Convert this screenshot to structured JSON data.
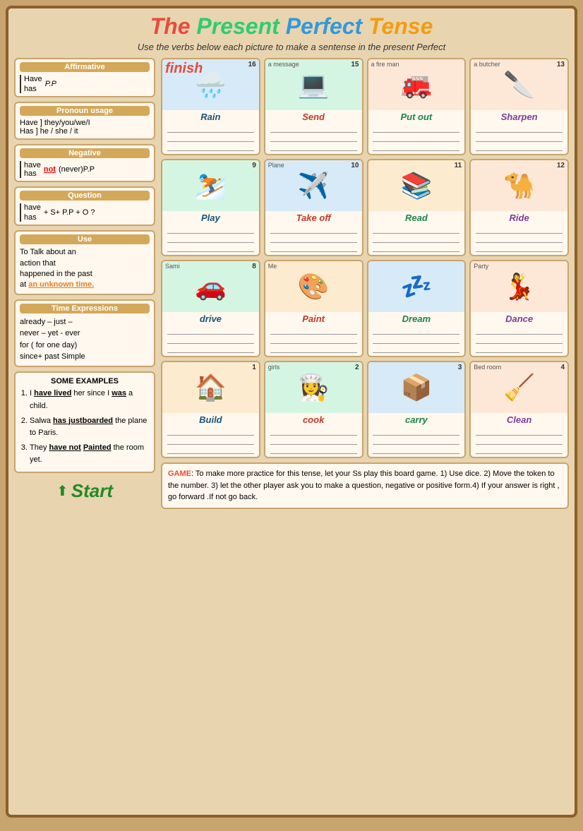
{
  "title": {
    "the": "The ",
    "present": "Present ",
    "perfect": "Perfect ",
    "tense": "Tense"
  },
  "subtitle": "Use the verbs below each picture to make a sentense in the present Perfect",
  "affirmative": {
    "title": "Affirmative",
    "have": "Have",
    "has": "has",
    "pp": "P.P"
  },
  "pronoun": {
    "title": "Pronoun usage",
    "line1": "Have ] they/you/we/I",
    "line2": "Has ] he / she / it"
  },
  "negative": {
    "title": "Negative",
    "have": "have",
    "has": "has",
    "not_text": "not",
    "pp": "(never)P.P"
  },
  "question": {
    "title": "Question",
    "have": "have",
    "has": "has",
    "formula": "+ S+ P.P + O ?"
  },
  "use": {
    "title": "Use",
    "line1": "To Talk about an",
    "line2": "action that",
    "line3": "happened in the past",
    "line4_pre": "at ",
    "line4_highlight": "an unknown time.",
    "line4_highlight_color": "#e67e22"
  },
  "time_expressions": {
    "title": "Time Expressions",
    "line1": "already – just –",
    "line2": "never – yet - ever",
    "line3": "for ( for one day)",
    "line4": "since+ past Simple"
  },
  "examples": {
    "title": "SOME EXAMPLES",
    "ex1_pre": "I ",
    "ex1_have": "have lived",
    "ex1_post": " her since I ",
    "ex1_was": "was",
    "ex1_end": " a child.",
    "ex2_pre": "Salwa ",
    "ex2_has": "has just",
    "ex2_boarded": "boarded",
    "ex2_post": " the plane to Paris.",
    "ex3_pre": "They ",
    "ex3_have": "have not",
    "ex3_painted": "Painted",
    "ex3_post": " the room yet."
  },
  "game": {
    "label": "GAME",
    "text": ": To make more practice for this tense, let your Ss play this board game. 1) Use dice. 2) Move the token to the number. 3) let the other player ask you to make a question, negative or positive form.4) If your answer is right , go forward .If not go back."
  },
  "cells": [
    {
      "num": "16",
      "verb": "Rain",
      "color": "#d6eaf8",
      "emoji": "🌧️",
      "label_type": "finish"
    },
    {
      "num": "15",
      "verb": "Send",
      "color": "#d5f5e3",
      "emoji": "💻",
      "small_label": "a message"
    },
    {
      "num": "",
      "verb": "Put out",
      "color": "#fde8d8",
      "emoji": "🚒",
      "small_label": "a fire man"
    },
    {
      "num": "13",
      "verb": "Sharpen",
      "color": "#fde8d8",
      "emoji": "🔪",
      "small_label": "a butcher"
    },
    {
      "num": "9",
      "verb": "Play",
      "color": "#d5f5e3",
      "emoji": "⛷️"
    },
    {
      "num": "10",
      "verb": "Take off",
      "color": "#d6eaf8",
      "emoji": "✈️",
      "small_label": "Plane"
    },
    {
      "num": "11",
      "verb": "Read",
      "color": "#fdebd0",
      "emoji": "📚"
    },
    {
      "num": "12",
      "verb": "Ride",
      "color": "#fde8d8",
      "emoji": "🐪"
    },
    {
      "num": "8",
      "verb": "drive",
      "color": "#d5f5e3",
      "emoji": "🚗",
      "small_label": "Sami"
    },
    {
      "num": "",
      "verb": "Paint",
      "color": "#fdebd0",
      "emoji": "🎨",
      "small_label": "Me"
    },
    {
      "num": "",
      "verb": "Dream",
      "color": "#d6eaf8",
      "emoji": "💤"
    },
    {
      "num": "",
      "verb": "Dance",
      "color": "#fde8d8",
      "emoji": "💃",
      "small_label": "Party"
    },
    {
      "num": "1",
      "verb": "Build",
      "color": "#fdebd0",
      "emoji": "🏠"
    },
    {
      "num": "2",
      "verb": "cook",
      "color": "#d5f5e3",
      "emoji": "👩‍🍳",
      "small_label": "girls"
    },
    {
      "num": "3",
      "verb": "carry",
      "color": "#d6eaf8",
      "emoji": "📦"
    },
    {
      "num": "4",
      "verb": "Clean",
      "color": "#fde8d8",
      "emoji": "🧹",
      "small_label": "Bed room"
    }
  ]
}
